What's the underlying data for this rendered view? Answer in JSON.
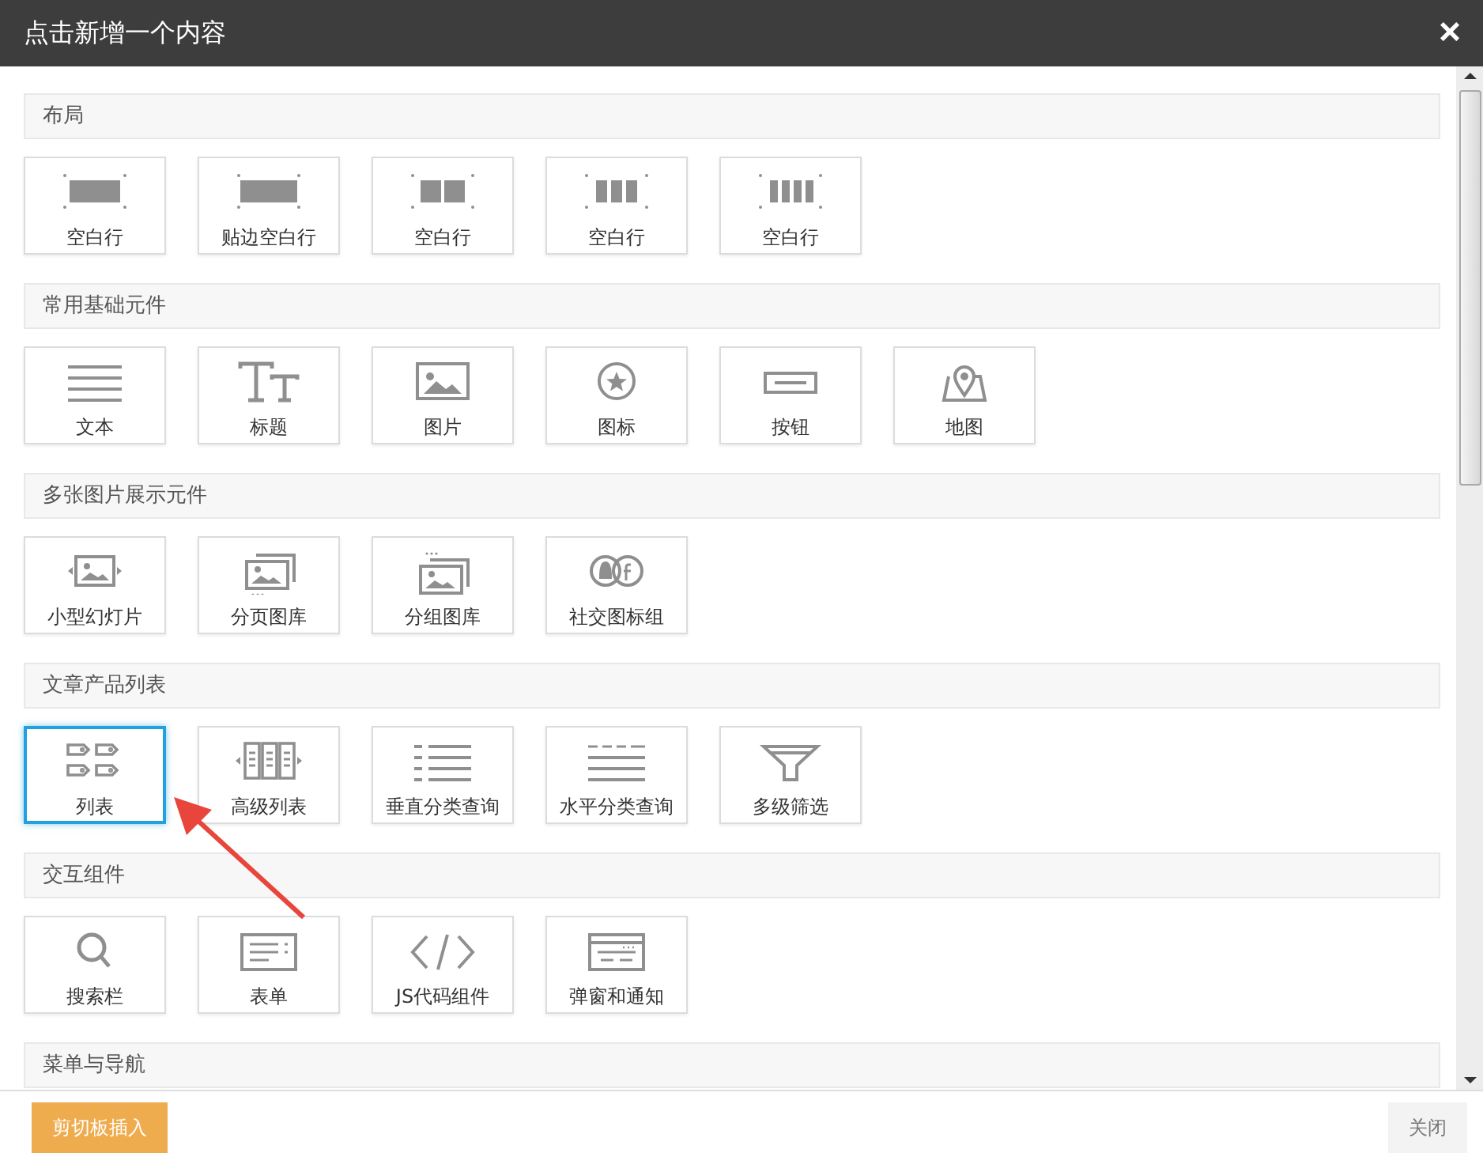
{
  "window": {
    "title": "点击新增一个内容",
    "close": "×"
  },
  "sections": [
    {
      "title": "布局",
      "items": [
        {
          "label": "空白行",
          "kind": "row1",
          "selected": false
        },
        {
          "label": "贴边空白行",
          "kind": "edgerow",
          "selected": false
        },
        {
          "label": "空白行",
          "kind": "row2",
          "selected": false
        },
        {
          "label": "空白行",
          "kind": "row3",
          "selected": false
        },
        {
          "label": "空白行",
          "kind": "row4",
          "selected": false
        }
      ]
    },
    {
      "title": "常用基础元件",
      "items": [
        {
          "label": "文本",
          "kind": "text",
          "selected": false
        },
        {
          "label": "标题",
          "kind": "heading",
          "selected": false
        },
        {
          "label": "图片",
          "kind": "image",
          "selected": false
        },
        {
          "label": "图标",
          "kind": "star",
          "selected": false
        },
        {
          "label": "按钮",
          "kind": "button",
          "selected": false
        },
        {
          "label": "地图",
          "kind": "map",
          "selected": false
        }
      ]
    },
    {
      "title": "多张图片展示元件",
      "items": [
        {
          "label": "小型幻灯片",
          "kind": "slider",
          "selected": false
        },
        {
          "label": "分页图库",
          "kind": "pagedgallery",
          "selected": false
        },
        {
          "label": "分组图库",
          "kind": "groupgallery",
          "selected": false
        },
        {
          "label": "社交图标组",
          "kind": "social",
          "selected": false
        }
      ]
    },
    {
      "title": "文章产品列表",
      "items": [
        {
          "label": "列表",
          "kind": "list",
          "selected": true
        },
        {
          "label": "高级列表",
          "kind": "advlist",
          "selected": false
        },
        {
          "label": "垂直分类查询",
          "kind": "vlist",
          "selected": false
        },
        {
          "label": "水平分类查询",
          "kind": "hlist",
          "selected": false
        },
        {
          "label": "多级筛选",
          "kind": "filter",
          "selected": false
        }
      ]
    },
    {
      "title": "交互组件",
      "items": [
        {
          "label": "搜索栏",
          "kind": "search",
          "selected": false
        },
        {
          "label": "表单",
          "kind": "form",
          "selected": false
        },
        {
          "label": "JS代码组件",
          "kind": "code",
          "selected": false
        },
        {
          "label": "弹窗和通知",
          "kind": "popup",
          "selected": false
        }
      ]
    },
    {
      "title": "菜单与导航"
    }
  ],
  "footer": {
    "paste_button": "剪切板插入",
    "close_button": "关闭"
  }
}
